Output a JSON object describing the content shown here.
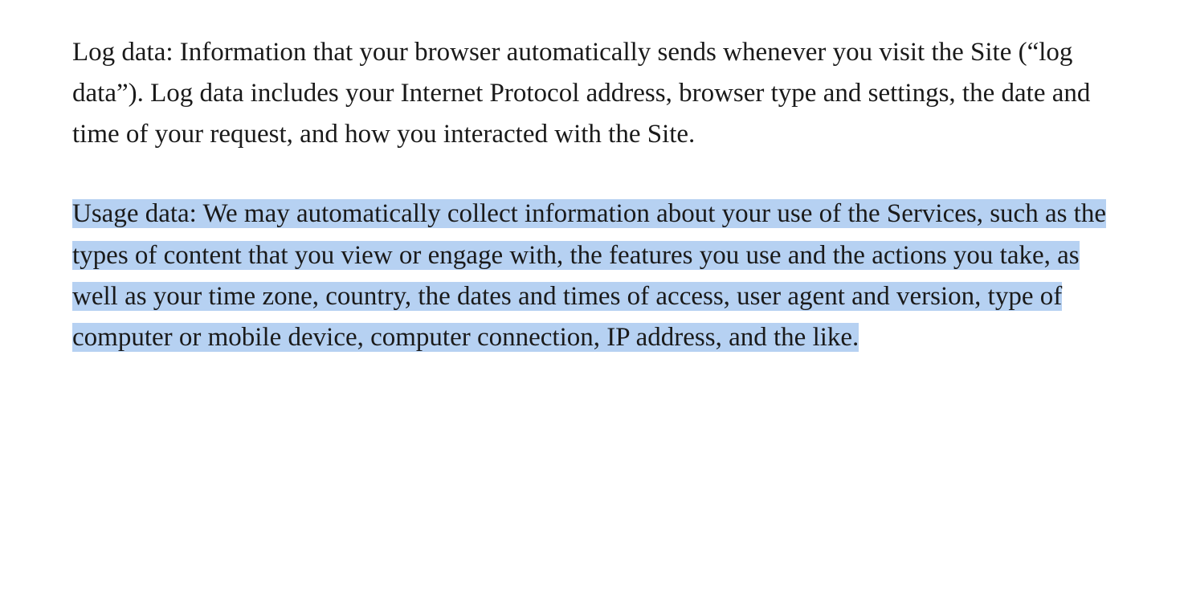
{
  "paragraphs": [
    {
      "text": "Log data: Information that your browser automatically sends whenever you visit the Site (“log data”). Log data includes your Internet Protocol address, browser type and settings, the date and time of your request, and how you interacted with the Site.",
      "highlighted": false
    },
    {
      "text": "Usage data: We may automatically collect information about your use of the Services, such as the types of content that you view or engage with, the features you use and the actions you take, as well as your time zone, country, the dates and times of access, user agent and version, type of computer or mobile device, computer connection, IP address, and the like.",
      "highlighted": true
    }
  ]
}
